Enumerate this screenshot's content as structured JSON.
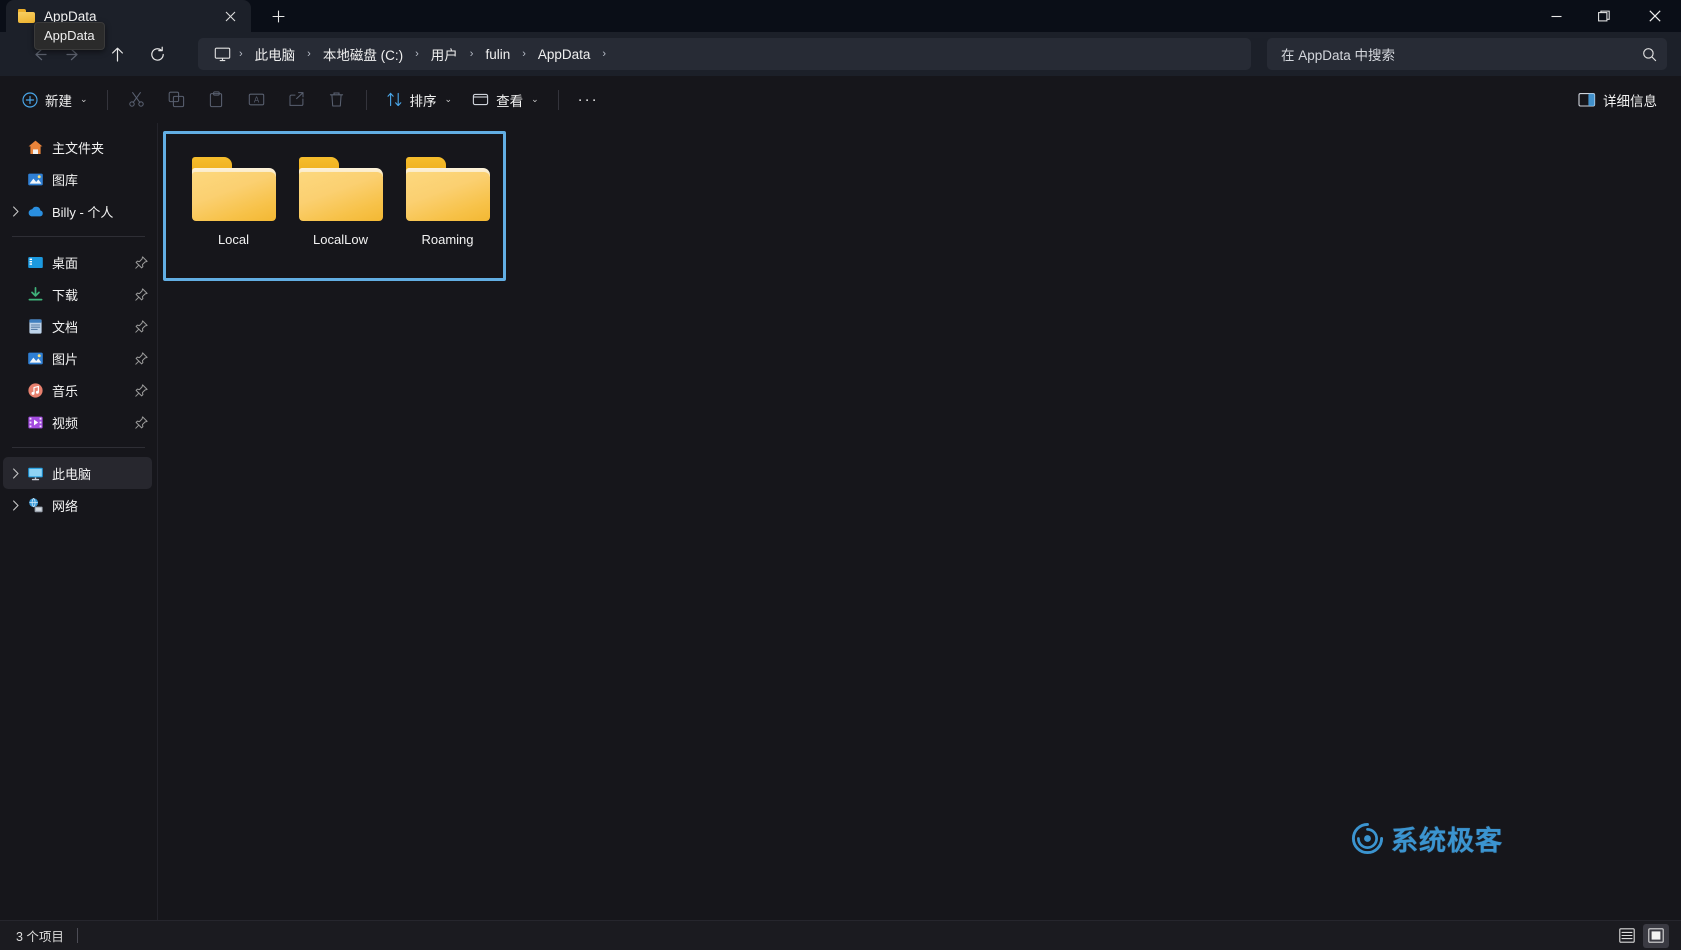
{
  "window": {
    "tab": {
      "title": "AppData",
      "icon": "folder-icon",
      "close_label": "✕"
    },
    "new_tab_label": "+",
    "tooltip": "AppData",
    "controls": {
      "minimize": "minimize-icon",
      "maximize": "maximize-icon",
      "close": "close-icon"
    }
  },
  "nav": {
    "back": "back-arrow-icon",
    "forward": "forward-arrow-icon",
    "up": "up-arrow-icon",
    "refresh": "refresh-icon",
    "breadcrumb": [
      "此电脑",
      "本地磁盘 (C:)",
      "用户",
      "fulin",
      "AppData"
    ],
    "separator": "›"
  },
  "search": {
    "placeholder": "在 AppData 中搜索",
    "icon": "search-icon"
  },
  "toolbar": {
    "new_label": "新建",
    "cut_label": "剪切",
    "copy_label": "复制",
    "paste_label": "粘贴",
    "rename_label": "重命名",
    "share_label": "共享",
    "delete_label": "删除",
    "sort_label": "排序",
    "view_label": "查看",
    "more_label": "···",
    "details_label": "详细信息",
    "chevron": "⌄"
  },
  "sidebar": {
    "groups": [
      {
        "items": [
          {
            "label": "主文件夹",
            "icon": "home-icon",
            "expandable": false,
            "pinned": false
          },
          {
            "label": "图库",
            "icon": "gallery-icon",
            "expandable": false,
            "pinned": false
          },
          {
            "label": "Billy - 个人",
            "icon": "onedrive-icon",
            "expandable": true,
            "pinned": false
          }
        ]
      },
      {
        "items": [
          {
            "label": "桌面",
            "icon": "desktop-icon",
            "expandable": false,
            "pinned": true
          },
          {
            "label": "下载",
            "icon": "downloads-icon",
            "expandable": false,
            "pinned": true
          },
          {
            "label": "文档",
            "icon": "documents-icon",
            "expandable": false,
            "pinned": true
          },
          {
            "label": "图片",
            "icon": "pictures-icon",
            "expandable": false,
            "pinned": true
          },
          {
            "label": "音乐",
            "icon": "music-icon",
            "expandable": false,
            "pinned": true
          },
          {
            "label": "视频",
            "icon": "videos-icon",
            "expandable": false,
            "pinned": true
          }
        ]
      },
      {
        "items": [
          {
            "label": "此电脑",
            "icon": "this-pc-icon",
            "expandable": true,
            "pinned": false,
            "selected": true
          },
          {
            "label": "网络",
            "icon": "network-icon",
            "expandable": true,
            "pinned": false
          }
        ]
      }
    ]
  },
  "files": [
    {
      "name": "Local",
      "icon": "folder-icon"
    },
    {
      "name": "LocalLow",
      "icon": "folder-icon"
    },
    {
      "name": "Roaming",
      "icon": "folder-icon"
    }
  ],
  "watermark": {
    "text": "系统极客",
    "icon": "spiral-logo-icon"
  },
  "status": {
    "item_count": "3 个项目",
    "list_view": "list-view-icon",
    "icons_view": "large-icons-view-icon"
  },
  "colors": {
    "accent_selection": "#62aee3",
    "folder_yellow": "#f7c249",
    "watermark_blue": "#3f9fe0",
    "titlebar_bg": "#0a0e17",
    "navbar_bg": "#1c2029",
    "content_bg": "#16161b"
  }
}
